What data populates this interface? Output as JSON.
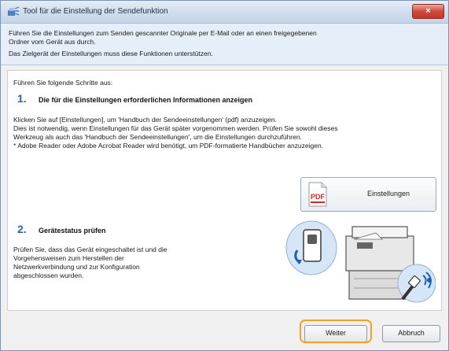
{
  "window": {
    "title": "Tool für die Einstellung der Sendefunktion",
    "close_label": "×"
  },
  "info": {
    "line1": "Führen Sie die Einstellungen zum Senden gescannter Originale per E-Mail oder an einen freigegebenen",
    "line2": "Ordner vom Gerät aus durch.",
    "line3": "Das Zielgerät der Einstellungen muss diese Funktionen unterstützen."
  },
  "main": {
    "intro": "Führen Sie folgende Schritte aus:",
    "step1": {
      "number": "1.",
      "title": "Die für die Einstellungen erforderlichen Informationen anzeigen",
      "desc1": "Klicken Sie auf [Einstellungen], um 'Handbuch der Sendeeinstellungen' (pdf) anzuzeigen.",
      "desc2": "Dies ist notwendig, wenn Einstellungen für das Gerät später vorgenommen werden. Prüfen Sie sowohl dieses",
      "desc3": "Werkzeug als auch das 'Handbuch der Sendeeinstellungen', um die Einstellungen durchzuführen.",
      "desc4": "* Adobe Reader oder Adobe Acrobat Reader wird benötigt, um PDF-formatierte Handbücher anzuzeigen.",
      "button_label": "Einstellungen",
      "pdf_icon_text": "PDF"
    },
    "step2": {
      "number": "2.",
      "title": "Gerätestatus prüfen",
      "desc1": "Prüfen Sie, dass das Gerät eingeschaltet ist und die",
      "desc2": "Vorgehensweisen zum Herstellen der",
      "desc3": "Netzwerkverbindung und zur Konfiguration",
      "desc4": "abgeschlossen wurden."
    }
  },
  "footer": {
    "next_label": "Weiter",
    "cancel_label": "Abbruch"
  },
  "colors": {
    "accent": "#2a63b4",
    "highlight": "#f2a02a"
  }
}
